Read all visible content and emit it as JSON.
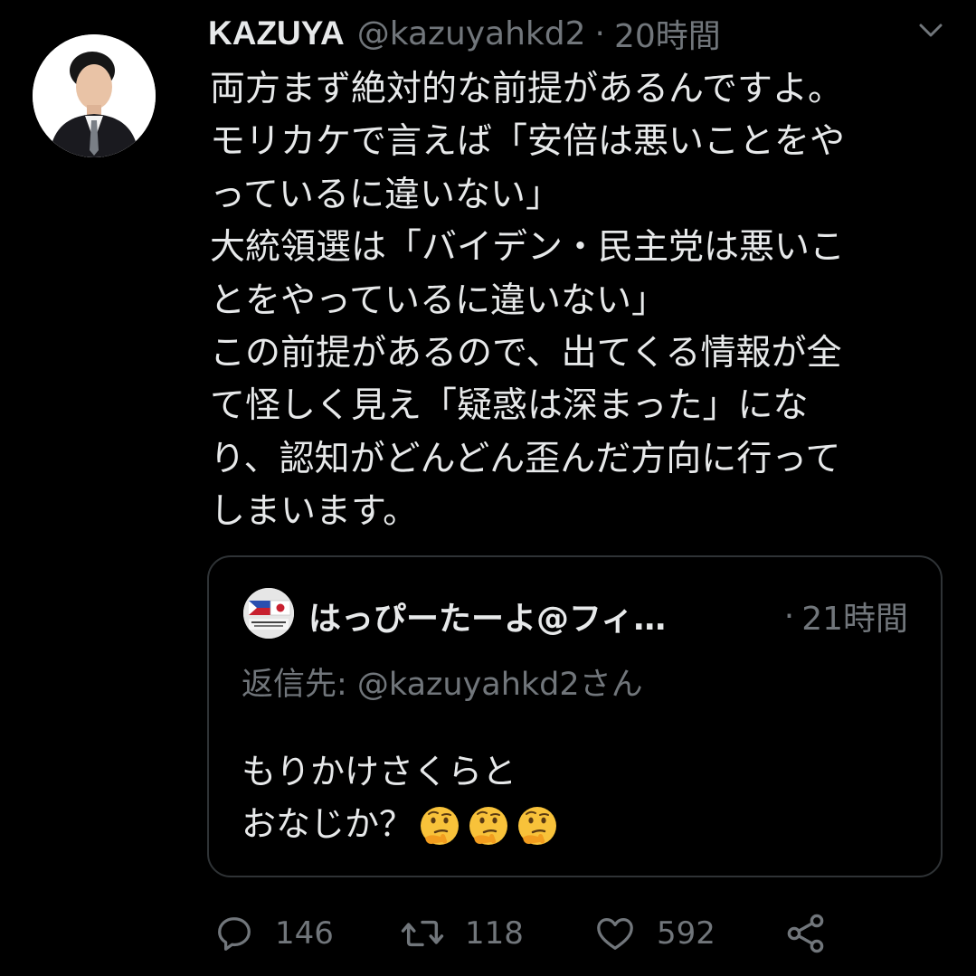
{
  "tweet": {
    "author": {
      "name": "KAZUYA",
      "handle": "@kazuyahkd2",
      "separator": "·",
      "time": "20時間"
    },
    "text_lines": [
      "両方まず絶対的な前提があるんですよ。",
      "モリカケで言えば「安倍は悪いことをや",
      "っているに違いない」",
      "大統領選は「バイデン・民主党は悪いこ",
      "とをやっているに違いない」",
      "この前提があるので、出てくる情報が全",
      "て怪しく見え「疑惑は深まった」にな",
      "り、認知がどんどん歪んだ方向に行って",
      "しまいます。"
    ]
  },
  "quoted_tweet": {
    "author_name": "はっぴーたーよ@フィ…",
    "separator": "·",
    "time": "21時間",
    "reply_to": "返信先: @kazuyahkd2さん",
    "text_lines": [
      "もりかけさくらと",
      "おなじか？"
    ],
    "emojis": [
      "thinking-face",
      "thinking-face",
      "thinking-face"
    ]
  },
  "actions": {
    "reply_count": "146",
    "retweet_count": "118",
    "like_count": "592"
  },
  "colors": {
    "background": "#000000",
    "text_primary": "#e7e9ea",
    "text_secondary": "#71767b",
    "border": "#2f3336"
  }
}
